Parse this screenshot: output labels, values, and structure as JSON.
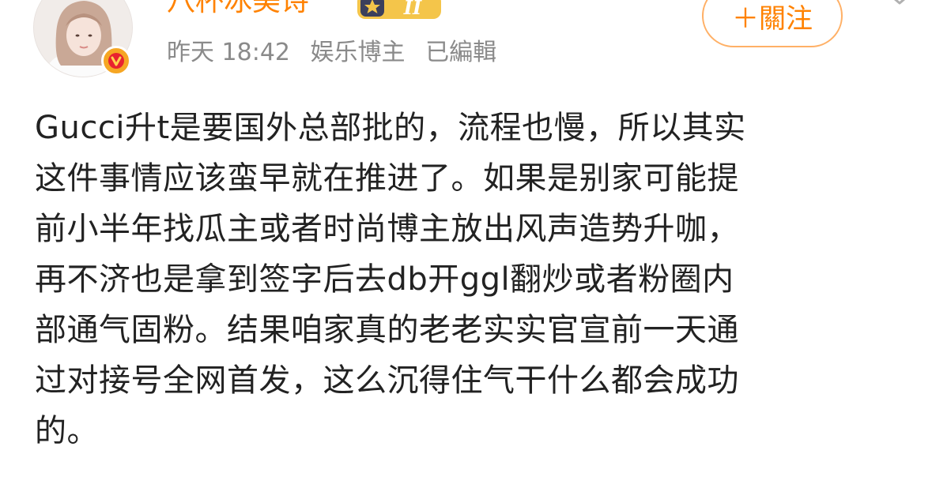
{
  "author": {
    "name": "八杯冰美诗",
    "level_badge_text": "II"
  },
  "meta": {
    "time": "昨天 18:42",
    "category": "娱乐博主",
    "edited": "已編輯"
  },
  "follow_button": {
    "label": "＋關注"
  },
  "body": {
    "lines": [
      "Gucci升t是要国外总部批的，流程也慢，所以其实",
      "这件事情应该蛮早就在推进了。如果是别家可能提",
      "前小半年找瓜主或者时尚博主放出风声造势升咖，",
      "再不济也是拿到签字后去db开ggl翻炒或者粉圈内",
      "部通气固粉。结果咱家真的老老实实官宣前一天通",
      "过对接号全网首发，这么沉得住气干什么都会成功",
      "的。"
    ]
  },
  "colors": {
    "accent": "#ff8200",
    "verified": "#f6a623",
    "meta_text": "#8a8a8a",
    "body_text": "#222222"
  },
  "icons": {
    "verified": "verified-v-icon",
    "more": "chevron-down-icon"
  }
}
